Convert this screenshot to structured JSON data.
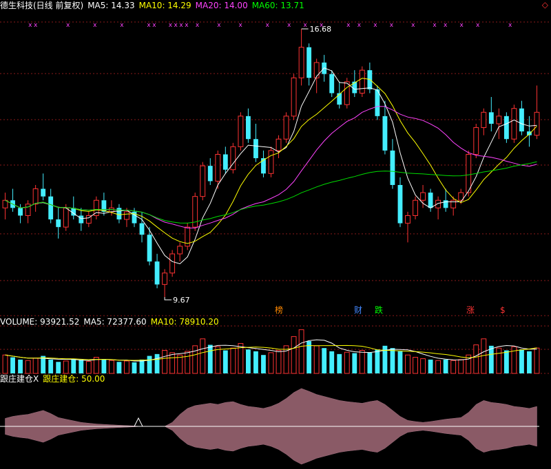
{
  "header": {
    "title": "德生科技(日线 前复权)",
    "ma5": "MA5: 14.33",
    "ma10": "MA10: 14.29",
    "ma20": "MA20: 14.00",
    "ma60": "MA60: 13.71",
    "corner_icon": "diamond-icon"
  },
  "price_labels": {
    "high": "16.68",
    "low": "9.67"
  },
  "event_labels": [
    {
      "text": "榜",
      "color": "#ff8800"
    },
    {
      "text": "财",
      "color": "#4488ff"
    },
    {
      "text": "跌",
      "color": "#00ff00"
    },
    {
      "text": "涨",
      "color": "#ff3333"
    },
    {
      "text": "$",
      "color": "#ff3333"
    }
  ],
  "volume": {
    "label": "VOLUME: 93921.52",
    "ma5": "MA5: 72377.60",
    "ma10": "MA10: 78910.20"
  },
  "indicator": {
    "name": "跟庄建仓X",
    "series_label": "跟庄建仓: 50.00"
  },
  "chart_data": {
    "type": "candlestick",
    "ohlc": [
      [
        12.0,
        12.4,
        11.7,
        12.2
      ],
      [
        12.2,
        12.5,
        11.9,
        12.0
      ],
      [
        12.0,
        12.1,
        11.6,
        11.8
      ],
      [
        11.8,
        12.2,
        11.6,
        12.1
      ],
      [
        12.1,
        12.6,
        11.9,
        12.5
      ],
      [
        12.5,
        12.9,
        12.2,
        12.3
      ],
      [
        12.3,
        12.5,
        11.6,
        11.7
      ],
      [
        11.7,
        12.0,
        11.2,
        11.5
      ],
      [
        11.5,
        12.1,
        11.4,
        12.0
      ],
      [
        12.0,
        12.3,
        11.7,
        11.8
      ],
      [
        11.8,
        12.0,
        11.4,
        11.6
      ],
      [
        11.6,
        11.9,
        11.5,
        11.8
      ],
      [
        11.8,
        12.3,
        11.7,
        12.2
      ],
      [
        12.2,
        12.4,
        11.8,
        11.9
      ],
      [
        11.9,
        12.2,
        11.8,
        12.0
      ],
      [
        12.0,
        12.1,
        11.6,
        11.7
      ],
      [
        11.7,
        12.0,
        11.5,
        11.9
      ],
      [
        11.9,
        12.0,
        11.5,
        11.6
      ],
      [
        11.6,
        11.9,
        11.1,
        11.3
      ],
      [
        11.3,
        11.5,
        10.5,
        10.6
      ],
      [
        10.6,
        10.8,
        9.9,
        10.0
      ],
      [
        10.0,
        10.4,
        9.67,
        10.3
      ],
      [
        10.3,
        10.9,
        10.2,
        10.8
      ],
      [
        10.8,
        11.1,
        10.6,
        11.0
      ],
      [
        11.0,
        11.6,
        10.9,
        11.5
      ],
      [
        11.5,
        12.4,
        11.4,
        12.3
      ],
      [
        12.3,
        13.2,
        12.2,
        13.1
      ],
      [
        13.1,
        13.3,
        12.6,
        12.7
      ],
      [
        12.7,
        13.5,
        12.5,
        13.4
      ],
      [
        13.4,
        13.6,
        12.9,
        13.0
      ],
      [
        13.0,
        13.7,
        12.9,
        13.6
      ],
      [
        13.6,
        14.5,
        13.5,
        14.4
      ],
      [
        14.4,
        14.6,
        13.7,
        13.8
      ],
      [
        13.8,
        14.2,
        13.2,
        13.3
      ],
      [
        13.3,
        13.5,
        12.8,
        12.9
      ],
      [
        12.9,
        13.6,
        12.8,
        13.5
      ],
      [
        13.5,
        13.9,
        13.3,
        13.8
      ],
      [
        13.8,
        14.5,
        13.7,
        14.4
      ],
      [
        14.4,
        15.5,
        14.3,
        15.4
      ],
      [
        15.4,
        16.68,
        15.2,
        16.2
      ],
      [
        16.2,
        16.3,
        15.2,
        15.4
      ],
      [
        15.4,
        15.9,
        15.0,
        15.8
      ],
      [
        15.8,
        16.0,
        15.3,
        15.5
      ],
      [
        15.5,
        15.6,
        14.9,
        15.0
      ],
      [
        15.0,
        15.3,
        14.6,
        14.7
      ],
      [
        14.7,
        15.4,
        14.6,
        15.3
      ],
      [
        15.3,
        15.6,
        14.9,
        15.0
      ],
      [
        15.0,
        15.7,
        14.9,
        15.6
      ],
      [
        15.6,
        15.8,
        15.0,
        15.1
      ],
      [
        15.1,
        15.2,
        14.3,
        14.4
      ],
      [
        14.4,
        14.8,
        13.4,
        13.5
      ],
      [
        13.5,
        13.8,
        12.5,
        12.6
      ],
      [
        12.6,
        12.8,
        11.5,
        11.6
      ],
      [
        11.6,
        11.9,
        11.1,
        11.8
      ],
      [
        11.8,
        12.3,
        11.7,
        12.2
      ],
      [
        12.2,
        12.6,
        12.0,
        12.4
      ],
      [
        12.4,
        12.5,
        11.9,
        12.0
      ],
      [
        12.0,
        12.3,
        11.7,
        12.2
      ],
      [
        12.2,
        12.5,
        11.9,
        12.0
      ],
      [
        12.0,
        12.3,
        11.8,
        12.2
      ],
      [
        12.2,
        12.5,
        12.1,
        12.4
      ],
      [
        12.4,
        13.5,
        12.3,
        13.4
      ],
      [
        13.4,
        14.2,
        13.3,
        14.1
      ],
      [
        14.1,
        14.6,
        13.9,
        14.5
      ],
      [
        14.5,
        14.9,
        14.0,
        14.2
      ],
      [
        14.2,
        14.6,
        13.8,
        14.4
      ],
      [
        14.4,
        14.5,
        13.7,
        13.8
      ],
      [
        13.8,
        14.7,
        13.7,
        14.6
      ],
      [
        14.6,
        14.8,
        13.9,
        14.0
      ],
      [
        14.0,
        14.4,
        13.6,
        13.9
      ],
      [
        13.9,
        15.2,
        13.8,
        14.5
      ]
    ],
    "ma_lines": [
      "MA5",
      "MA10",
      "MA20",
      "MA60"
    ],
    "volume_values": [
      40,
      35,
      30,
      28,
      33,
      38,
      30,
      25,
      27,
      32,
      30,
      26,
      35,
      30,
      28,
      25,
      27,
      24,
      30,
      38,
      42,
      50,
      45,
      40,
      48,
      60,
      75,
      62,
      58,
      50,
      55,
      65,
      52,
      48,
      40,
      45,
      50,
      60,
      80,
      95,
      70,
      60,
      55,
      48,
      42,
      46,
      44,
      50,
      45,
      52,
      60,
      55,
      48,
      40,
      35,
      32,
      30,
      28,
      30,
      28,
      30,
      40,
      62,
      75,
      60,
      55,
      50,
      58,
      52,
      48,
      55
    ],
    "indicator_values": [
      20,
      25,
      28,
      30,
      35,
      40,
      32,
      22,
      18,
      14,
      10,
      8,
      6,
      5,
      4,
      3,
      2,
      1,
      0,
      0,
      0,
      0,
      10,
      30,
      45,
      52,
      55,
      58,
      55,
      60,
      62,
      55,
      50,
      48,
      45,
      50,
      58,
      70,
      85,
      95,
      88,
      80,
      75,
      70,
      65,
      62,
      60,
      58,
      62,
      65,
      55,
      40,
      25,
      15,
      12,
      10,
      12,
      15,
      18,
      20,
      22,
      35,
      55,
      65,
      60,
      58,
      55,
      50,
      48,
      45,
      50
    ]
  }
}
